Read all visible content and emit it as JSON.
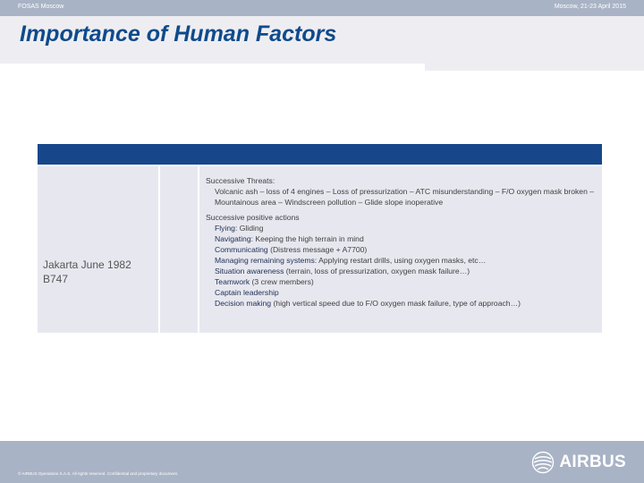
{
  "header": {
    "left": "FOSAS Moscow",
    "right": "Moscow, 21-23 April 2015"
  },
  "title": "Importance of Human Factors",
  "table": {
    "case": [
      "Jakarta June 1982",
      "B747"
    ],
    "threats_title": "Successive Threats:",
    "threats_text": "Volcanic ash – loss of 4 engines – Loss of pressurization – ATC misunderstanding – F/O oxygen mask broken – Mountainous area – Windscreen pollution – Glide slope inoperative",
    "actions_title": "Successive positive actions",
    "actions": [
      {
        "key": "Flying",
        "text": ": Gliding"
      },
      {
        "key": "Navigating",
        "text": ": Keeping the high terrain in mind"
      },
      {
        "key": "Communicating",
        "text": " (Distress message + A7700)"
      },
      {
        "key": "Managing remaining systems",
        "text": ": Applying restart drills, using oxygen masks, etc…"
      },
      {
        "key": "Situation awareness",
        "text": " (terrain, loss of pressurization, oxygen mask failure…)"
      },
      {
        "key": "Teamwork",
        "text": " (3 crew members)"
      },
      {
        "key": "Captain leadership",
        "text": ""
      },
      {
        "key": "Decision making",
        "text": " (high vertical speed due to F/O oxygen mask failure, type of approach…)"
      }
    ]
  },
  "footer": {
    "copyright": "© AIRBUS Operations S.A.S. All rights reserved. Confidential and proprietary document.",
    "logo_text": "AIRBUS",
    "logo_icon": "airbus-globe-icon"
  }
}
